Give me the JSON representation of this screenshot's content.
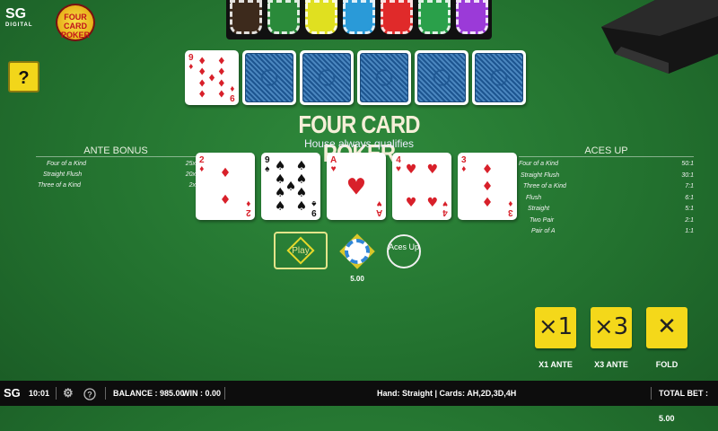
{
  "brand": {
    "sg_logo": "SG",
    "sg_sub": "DIGITAL",
    "game_logo": "FOUR CARD POKER"
  },
  "help_label": "?",
  "rack_chip_colors": [
    "#3d2a1c",
    "#2a8a3a",
    "#e0e020",
    "#2a9ad8",
    "#e02a2a",
    "#2aa04a",
    "#9b3ad8"
  ],
  "title": "FOUR CARD POKER",
  "subtitle": "House always qualifies",
  "dealer_cards": [
    {
      "rank": "9",
      "suit": "diamonds",
      "face_up": true
    },
    {
      "face_up": false
    },
    {
      "face_up": false
    },
    {
      "face_up": false
    },
    {
      "face_up": false
    },
    {
      "face_up": false
    }
  ],
  "player_cards": [
    {
      "rank": "2",
      "suit": "diamonds"
    },
    {
      "rank": "9",
      "suit": "spades"
    },
    {
      "rank": "A",
      "suit": "hearts"
    },
    {
      "rank": "4",
      "suit": "hearts"
    },
    {
      "rank": "3",
      "suit": "diamonds"
    }
  ],
  "ante_bonus": {
    "heading": "ANTE BONUS",
    "rows": [
      {
        "hand": "Four of a Kind",
        "pays": "25x"
      },
      {
        "hand": "Straight Flush",
        "pays": "20x"
      },
      {
        "hand": "Three of a Kind",
        "pays": "2x"
      }
    ]
  },
  "aces_up": {
    "heading": "ACES UP",
    "rows": [
      {
        "hand": "Four of a Kind",
        "pays": "50:1"
      },
      {
        "hand": "Straight Flush",
        "pays": "30:1"
      },
      {
        "hand": "Three of a Kind",
        "pays": "7:1"
      },
      {
        "hand": "Flush",
        "pays": "6:1"
      },
      {
        "hand": "Straight",
        "pays": "5:1"
      },
      {
        "hand": "Two Pair",
        "pays": "2:1"
      },
      {
        "hand": "Pair of A",
        "pays": "1:1"
      }
    ]
  },
  "spots": {
    "play_label": "Play",
    "ante_amount": "5.00",
    "aces_up_label": "Aces Up"
  },
  "actions": {
    "x1": {
      "icon": "×1",
      "label": "X1 ANTE"
    },
    "x3": {
      "icon": "×3",
      "label": "X3 ANTE"
    },
    "fold": {
      "icon": "✕",
      "label": "FOLD"
    }
  },
  "status_bar": {
    "logo": "SG",
    "clock": "10:01",
    "balance": "BALANCE : 985.00",
    "win": "WIN : 0.00",
    "hand_info": "Hand: Straight | Cards: AH,2D,3D,4H",
    "total_bet": "TOTAL BET : 5.00"
  }
}
